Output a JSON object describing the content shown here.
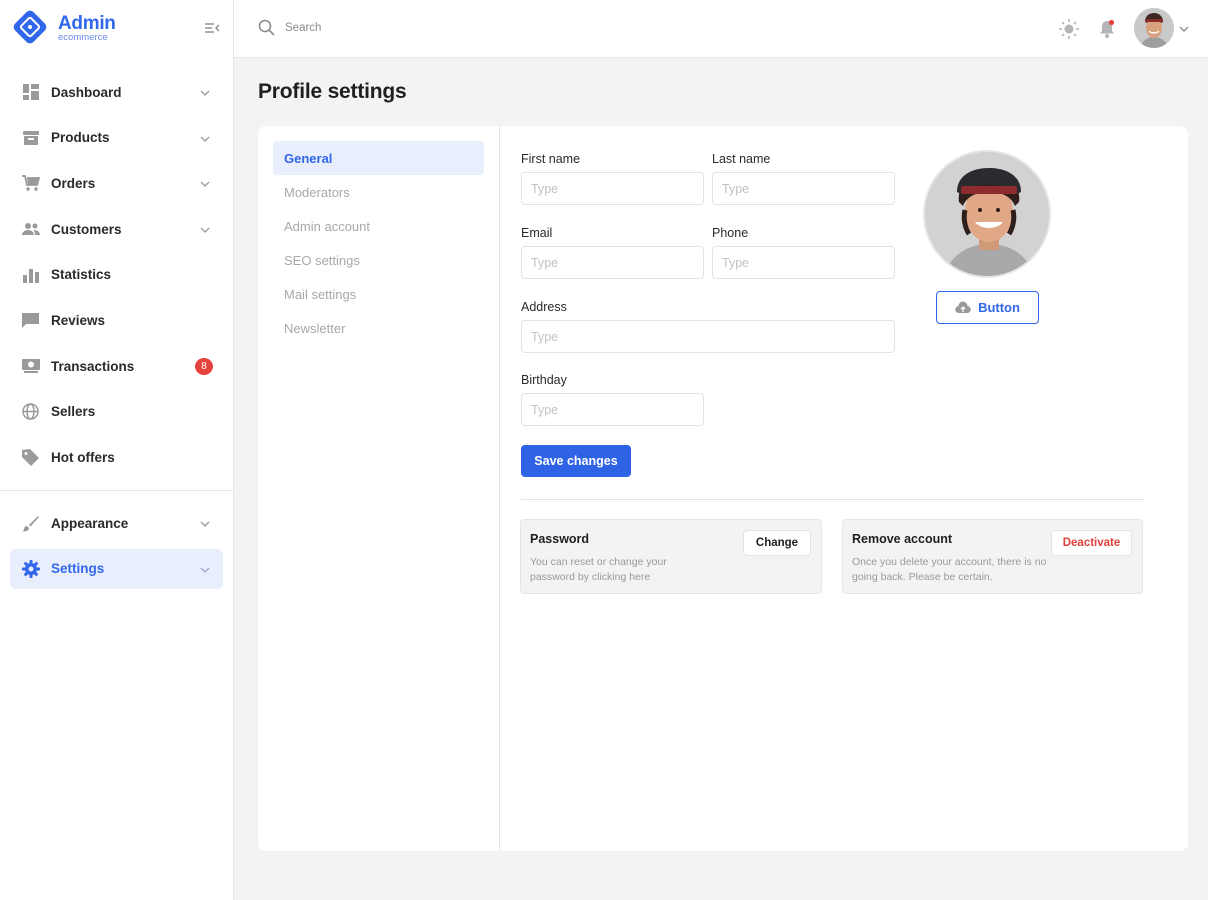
{
  "brand": {
    "title": "Admin",
    "subtitle": "ecommerce",
    "accent": "#3167eb"
  },
  "sidebar": {
    "items": [
      {
        "label": "Dashboard",
        "icon": "dashboard-icon",
        "chevron": true
      },
      {
        "label": "Products",
        "icon": "box-icon",
        "chevron": true
      },
      {
        "label": "Orders",
        "icon": "cart-icon",
        "chevron": true
      },
      {
        "label": "Customers",
        "icon": "people-icon",
        "chevron": true
      },
      {
        "label": "Statistics",
        "icon": "bar-chart-icon",
        "chevron": false
      },
      {
        "label": "Reviews",
        "icon": "comment-icon",
        "chevron": false
      },
      {
        "label": "Transactions",
        "icon": "money-icon",
        "badge": "8"
      },
      {
        "label": "Sellers",
        "icon": "globe-icon",
        "chevron": false
      },
      {
        "label": "Hot offers",
        "icon": "tag-icon",
        "chevron": false
      }
    ],
    "secondary": [
      {
        "label": "Appearance",
        "icon": "brush-icon",
        "chevron": true
      },
      {
        "label": "Settings",
        "icon": "gear-icon",
        "chevron": true,
        "active": true
      }
    ]
  },
  "header": {
    "search_placeholder": "Search"
  },
  "page": {
    "title": "Profile settings"
  },
  "subnav": {
    "items": [
      "General",
      "Moderators",
      "Admin account",
      "SEO settings",
      "Mail settings",
      "Newsletter"
    ],
    "active": "General"
  },
  "form": {
    "first_name": {
      "label": "First name",
      "placeholder": "Type",
      "value": ""
    },
    "last_name": {
      "label": "Last name",
      "placeholder": "Type",
      "value": ""
    },
    "email": {
      "label": "Email",
      "placeholder": "Type",
      "value": ""
    },
    "phone": {
      "label": "Phone",
      "placeholder": "Type",
      "value": ""
    },
    "address": {
      "label": "Address",
      "placeholder": "Type",
      "value": ""
    },
    "birthday": {
      "label": "Birthday",
      "placeholder": "Type",
      "value": ""
    },
    "save_label": "Save changes"
  },
  "photo": {
    "upload_label": "Button"
  },
  "password_panel": {
    "title": "Password",
    "description": "You can reset or change your password by clicking here",
    "button": "Change"
  },
  "remove_panel": {
    "title": "Remove account",
    "description": "Once you delete your account, there is no going back. Please be certain.",
    "button": "Deactivate",
    "danger_color": "#e0413a"
  },
  "badge_color": "#e5443d"
}
